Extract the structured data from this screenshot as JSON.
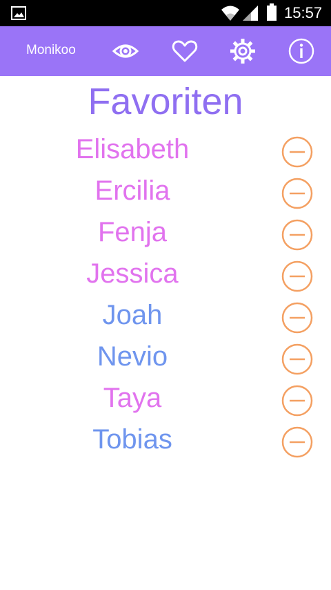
{
  "status_bar": {
    "time": "15:57",
    "icons": [
      "image-notification-icon",
      "wifi-icon",
      "signal-icon",
      "battery-icon"
    ]
  },
  "app_bar": {
    "app_name": "Monikoo",
    "actions": [
      "eye-icon",
      "heart-icon",
      "gear-icon",
      "info-icon"
    ],
    "color": "#9a74f7"
  },
  "title": "Favoriten",
  "colors": {
    "title": "#8f6ff1",
    "female": "#e173ee",
    "male": "#6f95ee",
    "remove": "#f4a062"
  },
  "favorites": [
    {
      "name": "Elisabeth",
      "color": "#e173ee"
    },
    {
      "name": "Ercilia",
      "color": "#e173ee"
    },
    {
      "name": "Fenja",
      "color": "#e173ee"
    },
    {
      "name": "Jessica",
      "color": "#e173ee"
    },
    {
      "name": "Joah",
      "color": "#6f95ee"
    },
    {
      "name": "Nevio",
      "color": "#6f95ee"
    },
    {
      "name": "Taya",
      "color": "#e173ee"
    },
    {
      "name": "Tobias",
      "color": "#6f95ee"
    }
  ],
  "remove_icon": "minus-circle-icon"
}
